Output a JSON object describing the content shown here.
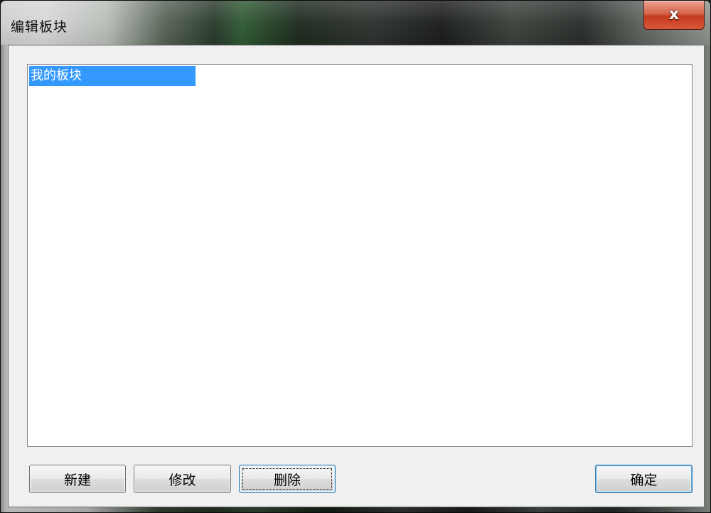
{
  "window": {
    "title": "编辑板块",
    "close_label": "x"
  },
  "list": {
    "items": [
      {
        "label": "我的板块",
        "selected": true
      }
    ]
  },
  "buttons": {
    "new_label": "新建",
    "edit_label": "修改",
    "delete_label": "删除",
    "ok_label": "确定"
  },
  "colors": {
    "selection": "#3399ff",
    "close_button": "#c43b1f"
  }
}
